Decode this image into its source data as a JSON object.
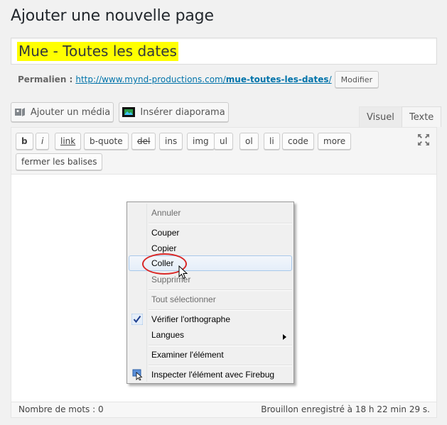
{
  "page": {
    "heading": "Ajouter une nouvelle page",
    "title_value": "Mue - Toutes les dates",
    "highlight_color": "#ffff00"
  },
  "permalink": {
    "label": "Permalien :",
    "url_base": "http://www.mynd-productions.com/",
    "slug": "mue-toutes-les-dates",
    "url_suffix": "/",
    "modify_label": "Modifier"
  },
  "media_buttons": {
    "add_media": {
      "label": "Ajouter un média",
      "icon": "media-icon"
    },
    "insert_slideshow": {
      "label": "Insérer diaporama",
      "icon": "slideshow-icon"
    }
  },
  "tabs": {
    "visual": "Visuel",
    "text": "Texte",
    "active": "text"
  },
  "quicktags": [
    "b",
    "i",
    "link",
    "b-quote",
    "del",
    "ins",
    "img",
    "ul",
    "ol",
    "li",
    "code",
    "more",
    "fermer les balises"
  ],
  "status": {
    "word_count": "Nombre de mots : 0",
    "draft": "Brouillon enregistré à 18 h 22 min 29 s."
  },
  "context_menu": {
    "items": [
      {
        "label": "Annuler",
        "disabled": true
      },
      {
        "label": "Couper",
        "disabled": false
      },
      {
        "label": "Copier",
        "disabled": false
      },
      {
        "label": "Coller",
        "disabled": false,
        "hovered": true
      },
      {
        "label": "Supprimer",
        "disabled": true
      },
      {
        "label": "Tout sélectionner",
        "disabled": true
      },
      {
        "label": "Vérifier l'orthographe",
        "checked": true
      },
      {
        "label": "Langues",
        "submenu": true
      },
      {
        "label": "Examiner l'élément"
      },
      {
        "label": "Inspecter l'élément avec Firebug",
        "icon": "firebug-icon"
      }
    ]
  },
  "colors": {
    "accent_link": "#0073aa",
    "annotation_ring": "#d92727",
    "menu_hover_border": "#a8c8ea"
  }
}
